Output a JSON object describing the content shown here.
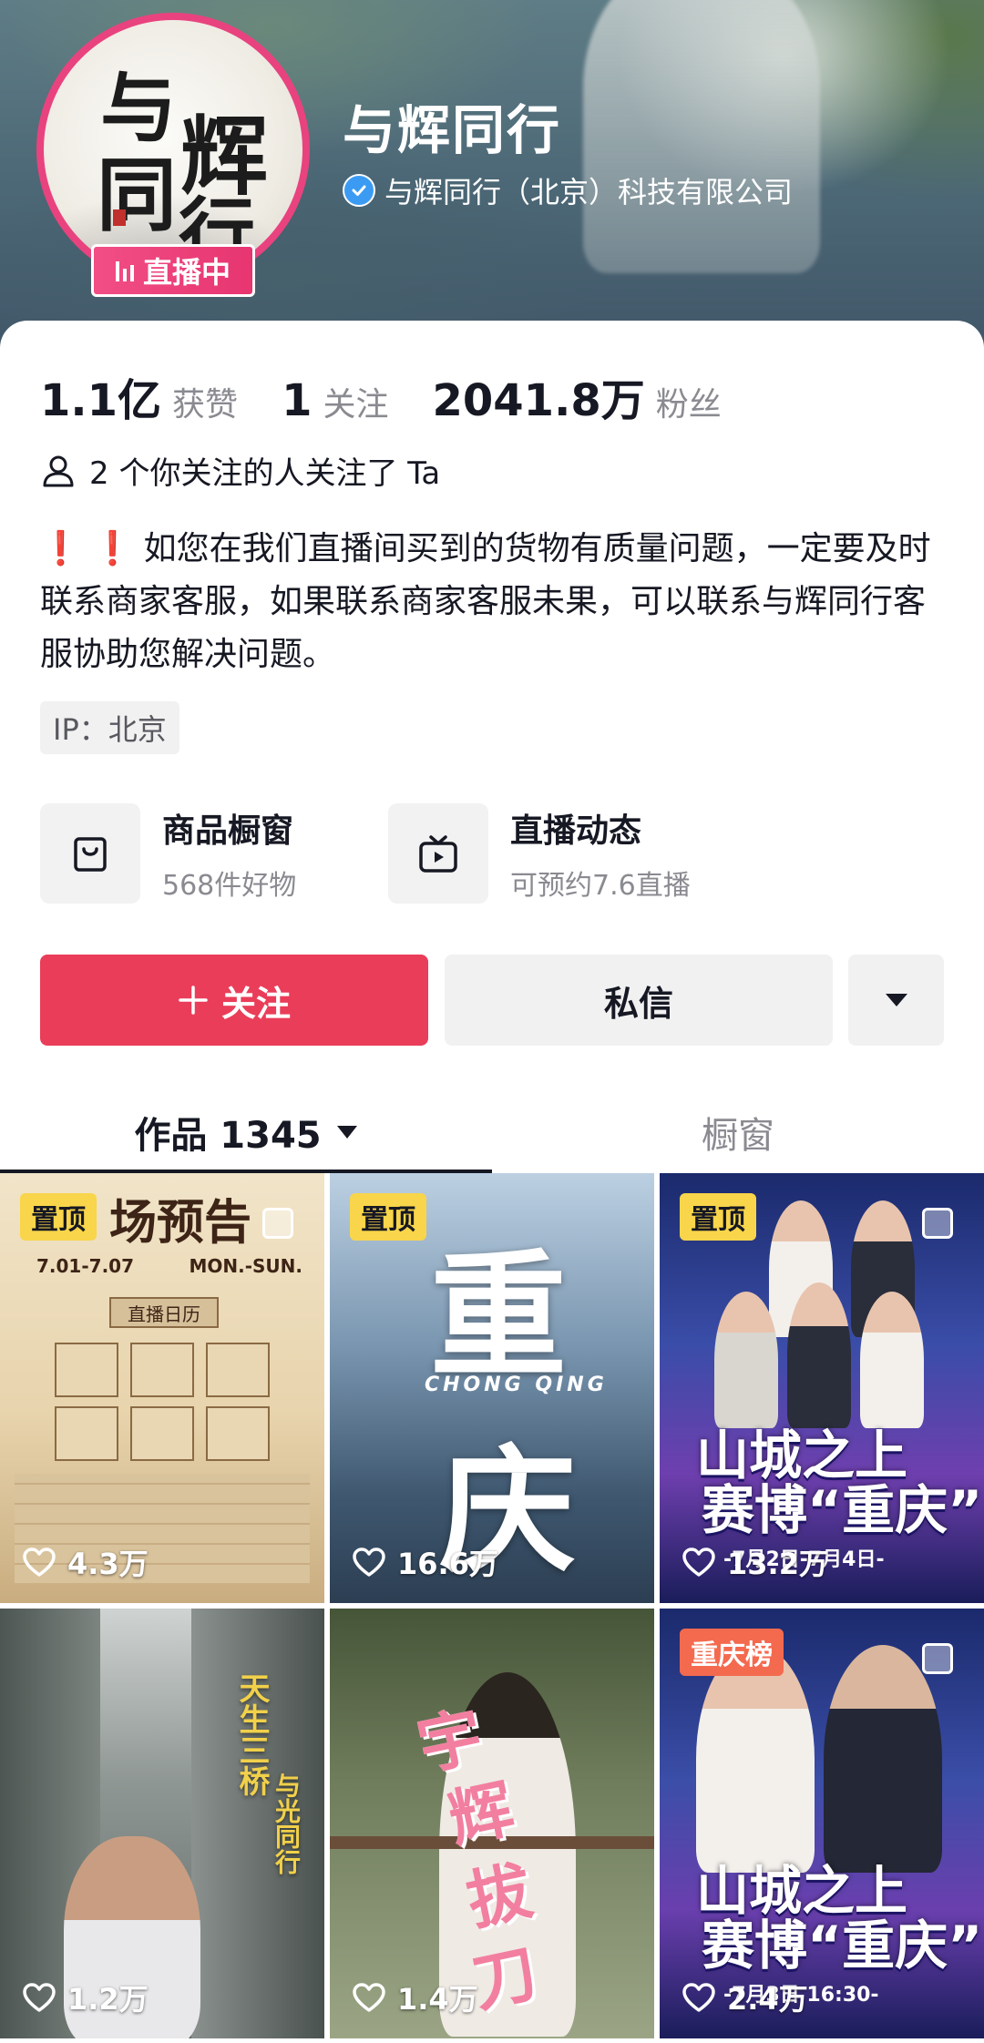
{
  "profile": {
    "name": "与辉同行",
    "verified_company": "与辉同行（北京）科技有限公司",
    "live_badge": "直播中",
    "avatar_text": {
      "c1": "与",
      "c2": "辉",
      "c3": "同",
      "c4": "行"
    }
  },
  "stats": [
    {
      "value": "1.1亿",
      "label": "获赞"
    },
    {
      "value": "1",
      "label": "关注"
    },
    {
      "value": "2041.8万",
      "label": "粉丝"
    }
  ],
  "mutual_text": "2 个你关注的人关注了 Ta",
  "bio": {
    "marks": "❗ ❗",
    "text": "如您在我们直播间买到的货物有质量问题，一定要及时联系商家客服，如果联系商家客服未果，可以联系与辉同行客服协助您解决问题。"
  },
  "ip_tag": "IP：北京",
  "features": {
    "shop": {
      "title": "商品橱窗",
      "subtitle": "568件好物"
    },
    "live": {
      "title": "直播动态",
      "subtitle": "可预约7.6直播"
    }
  },
  "buttons": {
    "follow": "关注",
    "message": "私信"
  },
  "tabs": {
    "works": "作品 1345",
    "showcase": "橱窗"
  },
  "videos": [
    {
      "badge": "置顶",
      "likes": "4.3万",
      "poster_title": "场预告",
      "poster_dates_left": "7.01-7.07",
      "poster_dates_right": "MON.-SUN.",
      "poster_sub": "直播日历"
    },
    {
      "badge": "置顶",
      "likes": "16.6万",
      "char_top": "重",
      "char_bottom": "庆",
      "sub": "CHONG QING"
    },
    {
      "badge": "置顶",
      "likes": "13.2万",
      "title_l1": "山城之上",
      "title_l2": "赛博“重庆”",
      "date": "-7月2日-7月4日-"
    },
    {
      "badge": "",
      "likes": "1.2万",
      "vtext1": "天生三桥",
      "vtext2": "与光同行"
    },
    {
      "badge": "",
      "likes": "1.4万",
      "pink1": "宇",
      "pink2": "辉",
      "pink3": "拔",
      "pink4": "刀"
    },
    {
      "badge": "重庆榜",
      "likes": "2.4万",
      "title_l1": "山城之上",
      "title_l2": "赛博“重庆”",
      "date": "-7月3日 16:30-"
    }
  ],
  "colors": {
    "follow_red": "#ea3d59",
    "live_pink": "#e73570",
    "pin_yellow": "#f8d54a",
    "pin_orange": "#f46a4f",
    "verify_blue": "#3b9bf3"
  }
}
